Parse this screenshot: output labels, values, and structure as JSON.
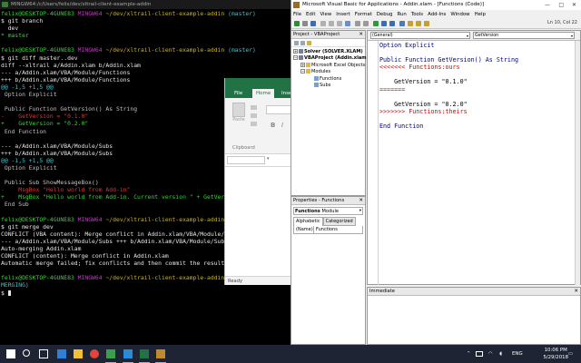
{
  "terminal": {
    "title": "MINGW64:/c/Users/felix/dev/xltrail-client-example-addin",
    "lines": [
      [
        {
          "t": "felix@DESKTOP-4GUNE83 ",
          "c": "green"
        },
        {
          "t": "MINGW64 ",
          "c": "magenta"
        },
        {
          "t": "~/dev/xltrail-client-example-addin ",
          "c": "yellow"
        },
        {
          "t": "(master)",
          "c": "cyan"
        }
      ],
      [
        {
          "t": "$ git branch",
          "c": "white"
        }
      ],
      [
        {
          "t": "  dev",
          "c": "white"
        }
      ],
      [
        {
          "t": "* master",
          "c": "green"
        }
      ],
      [
        {
          "t": "",
          "c": "white"
        }
      ],
      [
        {
          "t": "felix@DESKTOP-4GUNE83 ",
          "c": "green"
        },
        {
          "t": "MINGW64 ",
          "c": "magenta"
        },
        {
          "t": "~/dev/xltrail-client-example-addin ",
          "c": "yellow"
        },
        {
          "t": "(master)",
          "c": "cyan"
        }
      ],
      [
        {
          "t": "$ git diff master..dev",
          "c": "white"
        }
      ],
      [
        {
          "t": "diff --xltrail a/Addin.xlam b/Addin.xlam",
          "c": "white"
        }
      ],
      [
        {
          "t": "--- a/Addin.xlam/VBA/Module/Functions",
          "c": "white"
        }
      ],
      [
        {
          "t": "+++ b/Addin.xlam/VBA/Module/Functions",
          "c": "white"
        }
      ],
      [
        {
          "t": "@@ -1,5 +1,5 @@",
          "c": "cyan"
        }
      ],
      [
        {
          "t": " Option Explicit",
          "c": "grey"
        }
      ],
      [
        {
          "t": "",
          "c": "white"
        }
      ],
      [
        {
          "t": " Public Function GetVersion() As String",
          "c": "grey"
        }
      ],
      [
        {
          "t": "-    GetVersion = \"0.1.0\"",
          "c": "red"
        }
      ],
      [
        {
          "t": "+    GetVersion = \"0.2.0\"",
          "c": "green"
        }
      ],
      [
        {
          "t": " End Function",
          "c": "grey"
        }
      ],
      [
        {
          "t": "",
          "c": "white"
        }
      ],
      [
        {
          "t": "--- a/Addin.xlam/VBA/Module/Subs",
          "c": "white"
        }
      ],
      [
        {
          "t": "+++ b/Addin.xlam/VBA/Module/Subs",
          "c": "white"
        }
      ],
      [
        {
          "t": "@@ -1,5 +1,5 @@",
          "c": "cyan"
        }
      ],
      [
        {
          "t": " Option Explicit",
          "c": "grey"
        }
      ],
      [
        {
          "t": "",
          "c": "white"
        }
      ],
      [
        {
          "t": " Public Sub ShowMessageBox()",
          "c": "grey"
        }
      ],
      [
        {
          "t": "-    MsgBox \"Hello world from Add-in\"",
          "c": "red"
        }
      ],
      [
        {
          "t": "+    MsgBox \"Hello world from Add-in. Current version \" + GetVersion",
          "c": "green"
        }
      ],
      [
        {
          "t": " End Sub",
          "c": "grey"
        }
      ],
      [
        {
          "t": "",
          "c": "white"
        }
      ],
      [
        {
          "t": "felix@DESKTOP-4GUNE83 ",
          "c": "green"
        },
        {
          "t": "MINGW64 ",
          "c": "magenta"
        },
        {
          "t": "~/dev/xltrail-client-example-addin ",
          "c": "yellow"
        },
        {
          "t": "(master)",
          "c": "cyan"
        }
      ],
      [
        {
          "t": "$ git merge dev",
          "c": "white"
        }
      ],
      [
        {
          "t": "CONFLICT (VBA content): Merge conflict in Addin.xlam/VBA/Module/Functions",
          "c": "white"
        }
      ],
      [
        {
          "t": "--- a/Addin.xlam/VBA/Module/Subs +++ b/Addin.xlam/VBA/Module/Subs",
          "c": "white"
        }
      ],
      [
        {
          "t": "Auto-merging Addin.xlam",
          "c": "white"
        }
      ],
      [
        {
          "t": "CONFLICT (content): Merge conflict in Addin.xlam",
          "c": "white"
        }
      ],
      [
        {
          "t": "Automatic merge failed; fix conflicts and then commit the result.",
          "c": "white"
        }
      ],
      [
        {
          "t": "",
          "c": "white"
        }
      ],
      [
        {
          "t": "felix@DESKTOP-4GUNE83 ",
          "c": "green"
        },
        {
          "t": "MINGW64 ",
          "c": "magenta"
        },
        {
          "t": "~/dev/xltrail-client-example-addin ",
          "c": "yellow"
        },
        {
          "t": "(master|",
          "c": "cyan"
        }
      ],
      [
        {
          "t": "MERGING)",
          "c": "cyan"
        }
      ],
      [
        {
          "t": "$ ",
          "c": "white"
        }
      ]
    ]
  },
  "excel": {
    "tab_file": "File",
    "tab_home": "Home",
    "tab_insert": "Inse",
    "paste_label": "Paste",
    "bold": "B",
    "italic": "I",
    "clipboard_label": "Clipboard",
    "namebox_arrow": "▾",
    "status_ready": "Ready"
  },
  "vbe": {
    "title": "Microsoft Visual Basic for Applications - Addin.xlam - [Functions (Code)]",
    "window_controls": {
      "min": "—",
      "max": "□",
      "close": "✕"
    },
    "menu": [
      "File",
      "Edit",
      "View",
      "Insert",
      "Format",
      "Debug",
      "Run",
      "Tools",
      "Add-Ins",
      "Window",
      "Help"
    ],
    "cursor_pos": "Ln 10, Col 22",
    "project_panel": {
      "title": "Project - VBAProject",
      "close": "✕",
      "tree": [
        {
          "indent": 0,
          "box": "+",
          "label": "Solver (SOLVER.XLAM)",
          "bold": true,
          "icon": "vba-project-icon"
        },
        {
          "indent": 0,
          "box": "−",
          "label": "VBAProject (Addin.xlam)",
          "bold": true,
          "icon": "vba-project-icon"
        },
        {
          "indent": 1,
          "box": "+",
          "label": "Microsoft Excel Objects",
          "bold": false,
          "icon": "folder-icon"
        },
        {
          "indent": 1,
          "box": "−",
          "label": "Modules",
          "bold": false,
          "icon": "folder-icon"
        },
        {
          "indent": 2,
          "box": "",
          "label": "Functions",
          "bold": false,
          "icon": "module-icon"
        },
        {
          "indent": 2,
          "box": "",
          "label": "Subs",
          "bold": false,
          "icon": "module-icon"
        }
      ]
    },
    "properties_panel": {
      "title": "Properties - Functions",
      "close": "✕",
      "selector_name": "Functions",
      "selector_type": "Module",
      "tab_alphabetic": "Alphabetic",
      "tab_categorized": "Categorized",
      "prop_name": "(Name)",
      "prop_value": "Functions"
    },
    "code_window": {
      "object_combo": "(General)",
      "proc_combo": "GetVersion",
      "lines": [
        {
          "t": "Option Explicit",
          "c": "kw"
        },
        {
          "t": "",
          "c": "txt"
        },
        {
          "t": "Public Function GetVersion() As String",
          "c": "kw"
        },
        {
          "t": "<<<<<<< Functions:ours",
          "c": "cfl"
        },
        {
          "t": "",
          "c": "txt"
        },
        {
          "t": "    GetVersion = \"0.1.0\"",
          "c": "txt"
        },
        {
          "t": "=======",
          "c": "cfl"
        },
        {
          "t": "",
          "c": "txt"
        },
        {
          "t": "    GetVersion = \"0.2.0\"",
          "c": "txt"
        },
        {
          "t": ">>>>>>> Functions:theirs",
          "c": "cfl"
        },
        {
          "t": "",
          "c": "txt"
        },
        {
          "t": "End Function",
          "c": "kw"
        }
      ]
    },
    "immediate": {
      "title": "Immediate",
      "close": "✕"
    }
  },
  "taskbar": {
    "apps": [
      {
        "name": "windows-start",
        "color": "#ffffff"
      },
      {
        "name": "search",
        "color": "#ffffff"
      },
      {
        "name": "task-view",
        "color": "#ffffff"
      },
      {
        "name": "edge",
        "color": "#2f7fd6"
      },
      {
        "name": "file-explorer",
        "color": "#f2c230"
      },
      {
        "name": "chrome",
        "color": "#e0453a"
      },
      {
        "name": "git-bash",
        "color": "#3a9e4a"
      },
      {
        "name": "vscode",
        "color": "#2a8ad8"
      },
      {
        "name": "excel",
        "color": "#217346"
      },
      {
        "name": "vba-editor",
        "color": "#c08a2a"
      }
    ],
    "tray_lang": "ENG",
    "time": "10:06 PM",
    "date": "5/29/2018",
    "notifications_icon": "action-center-icon"
  }
}
